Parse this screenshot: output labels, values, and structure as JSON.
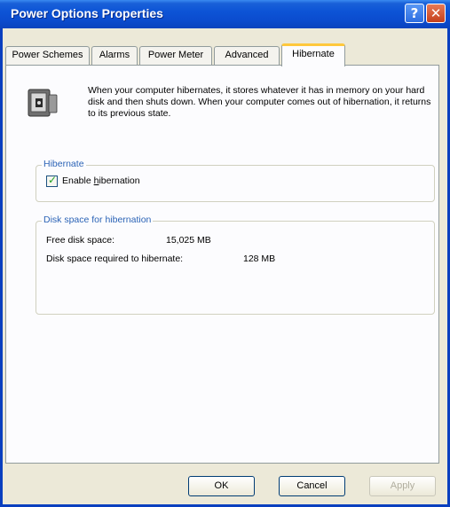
{
  "window": {
    "title": "Power Options Properties"
  },
  "titlebar": {
    "help_icon": "help-icon",
    "help_glyph": "?",
    "close_icon": "close-icon",
    "close_glyph": "✕"
  },
  "tabs": [
    {
      "label": "Power Schemes"
    },
    {
      "label": "Alarms"
    },
    {
      "label": "Power Meter"
    },
    {
      "label": "Advanced"
    },
    {
      "label": "Hibernate",
      "active": true
    }
  ],
  "intro": {
    "icon": "hibernate-computer-icon",
    "text": "When your computer hibernates, it stores whatever it has in memory on your hard disk and then shuts down. When your computer comes out of hibernation, it returns to its previous state."
  },
  "hibernate_group": {
    "label": "Hibernate",
    "checkbox_label_prefix": "Enable ",
    "checkbox_label_hotkey": "h",
    "checkbox_label_rest": "ibernation",
    "checked": true
  },
  "disk_group": {
    "label": "Disk space for hibernation",
    "free_label": "Free disk space:",
    "free_value": "15,025 MB",
    "required_label": "Disk space required to hibernate:",
    "required_value": "128 MB"
  },
  "buttons": {
    "ok": "OK",
    "cancel": "Cancel",
    "apply": "Apply"
  }
}
